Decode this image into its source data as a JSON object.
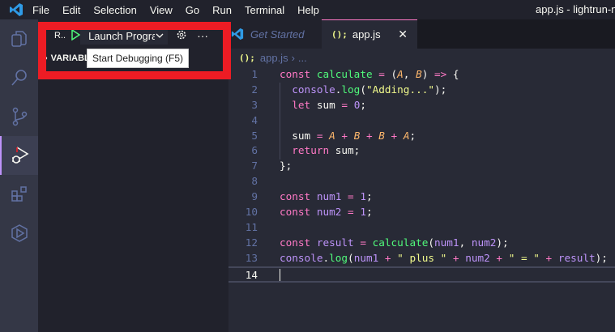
{
  "titlebar": {
    "menu": [
      "File",
      "Edit",
      "Selection",
      "View",
      "Go",
      "Run",
      "Terminal",
      "Help"
    ],
    "window_title": "app.js - lightrun-no"
  },
  "activity_bar": [
    {
      "icon": "explorer-icon"
    },
    {
      "icon": "search-icon"
    },
    {
      "icon": "source-control-icon"
    },
    {
      "icon": "run-debug-icon",
      "active": true
    },
    {
      "icon": "extensions-icon"
    },
    {
      "icon": "lightrun-icon"
    }
  ],
  "sidebar": {
    "header_short": "R..",
    "launch_config": "Launch Program",
    "variables_label": "VARIABLES",
    "tooltip": "Start Debugging (F5)"
  },
  "tabs": [
    {
      "label": "Get Started",
      "active": false
    },
    {
      "label": "app.js",
      "active": true,
      "icon": "(){}"
    }
  ],
  "breadcrumb": {
    "file": "app.js",
    "rest": "..."
  },
  "highlight_color": "#ed1c24",
  "editor": {
    "current_line": 14,
    "lines": [
      [
        [
          "const ",
          "k"
        ],
        [
          "calculate",
          "f"
        ],
        [
          " = ",
          "o"
        ],
        [
          "(",
          "t"
        ],
        [
          "A",
          "p"
        ],
        [
          ", ",
          "t"
        ],
        [
          "B",
          "p"
        ],
        [
          ") ",
          "t"
        ],
        [
          "=>",
          "k"
        ],
        [
          " {",
          "t"
        ]
      ],
      [
        [
          "  ",
          "t"
        ],
        [
          "console",
          "v"
        ],
        [
          ".",
          "t"
        ],
        [
          "log",
          "f"
        ],
        [
          "(",
          "t"
        ],
        [
          "\"Adding...\"",
          "s"
        ],
        [
          ");",
          "t"
        ]
      ],
      [
        [
          "  ",
          "t"
        ],
        [
          "let ",
          "k"
        ],
        [
          "sum ",
          "t"
        ],
        [
          "= ",
          "o"
        ],
        [
          "0",
          "n"
        ],
        [
          ";",
          "t"
        ]
      ],
      [],
      [
        [
          "  ",
          "t"
        ],
        [
          "sum ",
          "t"
        ],
        [
          "= ",
          "o"
        ],
        [
          "A",
          "p"
        ],
        [
          " + ",
          "o"
        ],
        [
          "B",
          "p"
        ],
        [
          " + ",
          "o"
        ],
        [
          "B",
          "p"
        ],
        [
          " + ",
          "o"
        ],
        [
          "A",
          "p"
        ],
        [
          ";",
          "t"
        ]
      ],
      [
        [
          "  ",
          "t"
        ],
        [
          "return ",
          "k"
        ],
        [
          "sum;",
          "t"
        ]
      ],
      [
        [
          "};",
          "t"
        ]
      ],
      [],
      [
        [
          "const ",
          "k"
        ],
        [
          "num1 ",
          "v"
        ],
        [
          "= ",
          "o"
        ],
        [
          "1",
          "n"
        ],
        [
          ";",
          "t"
        ]
      ],
      [
        [
          "const ",
          "k"
        ],
        [
          "num2 ",
          "v"
        ],
        [
          "= ",
          "o"
        ],
        [
          "1",
          "n"
        ],
        [
          ";",
          "t"
        ]
      ],
      [],
      [
        [
          "const ",
          "k"
        ],
        [
          "result ",
          "v"
        ],
        [
          "= ",
          "o"
        ],
        [
          "calculate",
          "f"
        ],
        [
          "(",
          "t"
        ],
        [
          "num1",
          "v"
        ],
        [
          ", ",
          "t"
        ],
        [
          "num2",
          "v"
        ],
        [
          ");",
          "t"
        ]
      ],
      [
        [
          "console",
          "v"
        ],
        [
          ".",
          "t"
        ],
        [
          "log",
          "f"
        ],
        [
          "(",
          "t"
        ],
        [
          "num1",
          "v"
        ],
        [
          " + ",
          "o"
        ],
        [
          "\" plus \"",
          "s"
        ],
        [
          " + ",
          "o"
        ],
        [
          "num2",
          "v"
        ],
        [
          " + ",
          "o"
        ],
        [
          "\" = \"",
          "s"
        ],
        [
          " + ",
          "o"
        ],
        [
          "result",
          "v"
        ],
        [
          ");",
          "t"
        ]
      ],
      []
    ]
  }
}
